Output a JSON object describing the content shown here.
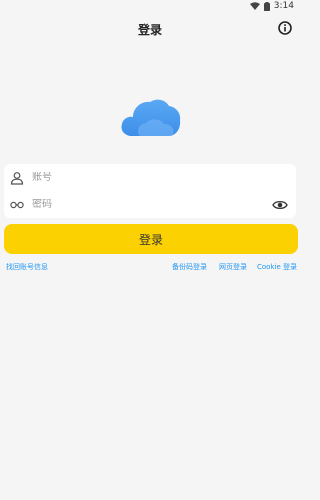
{
  "status_bar": {
    "time": "3:14"
  },
  "header": {
    "title": "登录",
    "info_icon": "info-icon"
  },
  "logo": {
    "icon": "cloud-icon",
    "color": "#4a9ff2"
  },
  "form": {
    "account_placeholder": "账号",
    "password_placeholder": "密码",
    "account_icon": "person-icon",
    "password_icon": "key-icon",
    "visibility_icon": "eye-icon"
  },
  "login_button": {
    "label": "登录",
    "color": "#fcd102"
  },
  "links": {
    "retrieve_account": "找回账号信息",
    "backup_code_login": "备份码登录",
    "web_login": "网页登录",
    "cookie_login": "Cookie 登录",
    "color": "#2196f3"
  }
}
